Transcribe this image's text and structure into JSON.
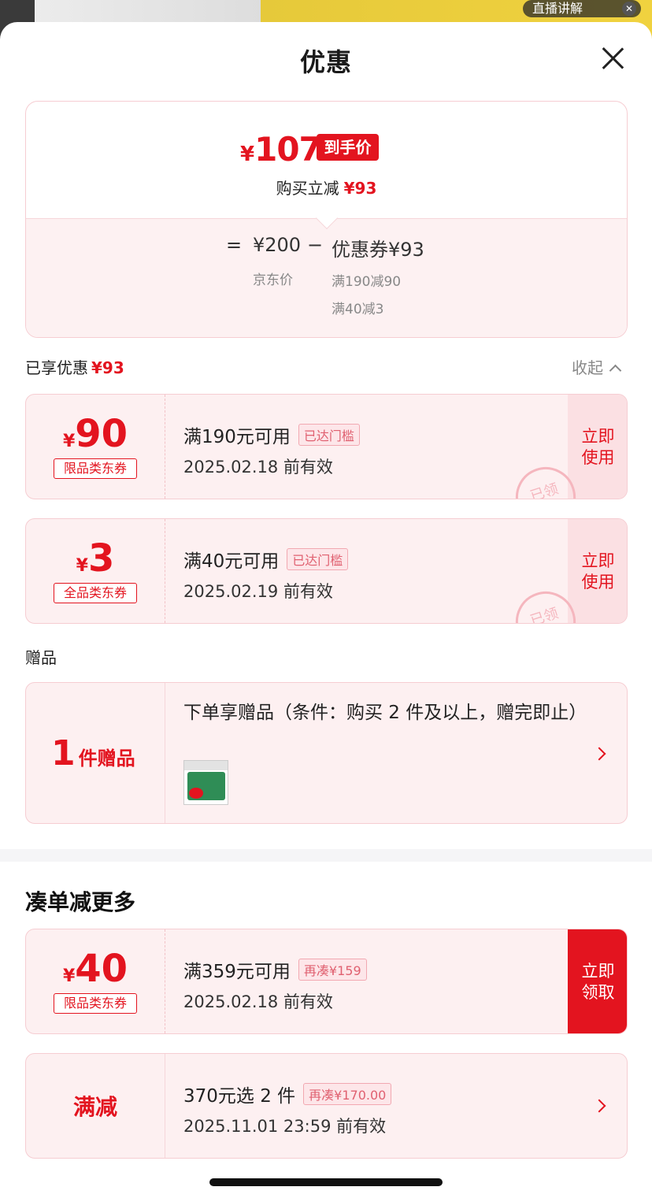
{
  "background": {
    "live_label": "直播讲解"
  },
  "sheet": {
    "title": "优惠"
  },
  "summary": {
    "currency": "¥",
    "final_price": "107",
    "final_badge": "到手价",
    "reduce_label": "购买立减",
    "reduce_value": "¥93",
    "equals": "=",
    "base_price": "¥200",
    "base_label": "京东价",
    "minus": "−",
    "coupon_total": "优惠券¥93",
    "conditions": [
      "满190减90",
      "满40减3"
    ]
  },
  "enjoyed": {
    "label": "已享优惠",
    "value": "¥93",
    "collapse_label": "收起"
  },
  "coupons": [
    {
      "currency": "¥",
      "value": "90",
      "tag": "限品类东券",
      "condition": "满190元可用",
      "status": "已达门槛",
      "valid": "2025.02.18 前有效",
      "action": "立即\n使用",
      "stamp": "已领"
    },
    {
      "currency": "¥",
      "value": "3",
      "tag": "全品类东券",
      "condition": "满40元可用",
      "status": "已达门槛",
      "valid": "2025.02.19 前有效",
      "action": "立即\n使用",
      "stamp": "已领"
    }
  ],
  "gift_section": {
    "label": "赠品",
    "count": "1",
    "unit": "件赠品",
    "description": "下单享赠品（条件：购买 2 件及以上，赠完即止）"
  },
  "more_section": {
    "title": "凑单减更多",
    "coupon": {
      "currency": "¥",
      "value": "40",
      "tag": "限品类东券",
      "condition": "满359元可用",
      "more": "再凑¥159",
      "valid": "2025.02.18 前有效",
      "action": "立即\n领取"
    },
    "full_reduction": {
      "label": "满减",
      "condition": "370元选 2 件",
      "more": "再凑¥170.00",
      "valid": "2025.11.01 23:59 前有效"
    }
  },
  "colors": {
    "accent": "#e3141f",
    "card_bg": "#fdf0f1",
    "card_border": "#f6cdd2"
  }
}
